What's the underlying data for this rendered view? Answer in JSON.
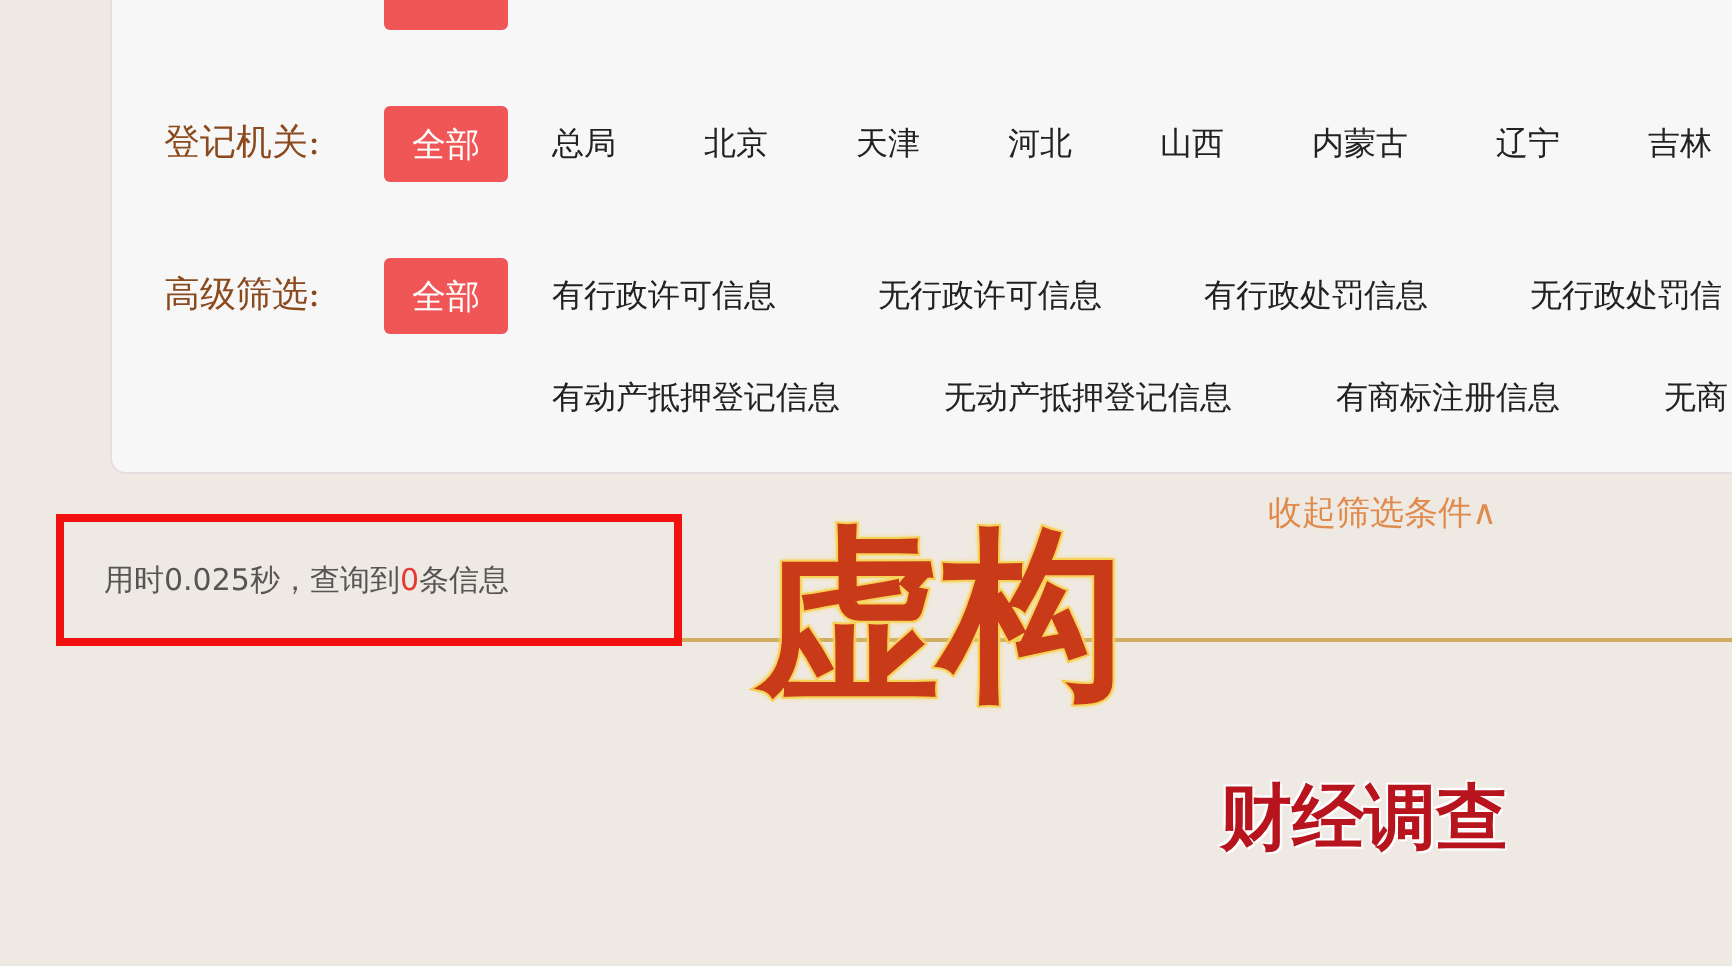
{
  "filters": [
    {
      "all_button": {
        "selected": true
      }
    },
    {
      "label": "登记机关:",
      "all_button": {
        "label": "全部",
        "selected": true
      },
      "lines": [
        [
          {
            "text": "总局",
            "selected": false
          },
          {
            "text": "北京",
            "selected": false
          },
          {
            "text": "天津",
            "selected": false
          },
          {
            "text": "河北",
            "selected": false
          },
          {
            "text": "山西",
            "selected": false
          },
          {
            "text": "内蒙古",
            "selected": false
          },
          {
            "text": "辽宁",
            "selected": false
          },
          {
            "text": "吉林",
            "selected": false
          }
        ]
      ]
    },
    {
      "label": "高级筛选:",
      "all_button": {
        "label": "全部",
        "selected": true
      },
      "lines": [
        [
          {
            "text": "有行政许可信息",
            "selected": false
          },
          {
            "text": "无行政许可信息",
            "selected": false
          },
          {
            "text": "有行政处罚信息",
            "selected": false
          },
          {
            "text": "无行政处罚信",
            "selected": false
          }
        ],
        [
          {
            "text": "有动产抵押登记信息",
            "selected": false
          },
          {
            "text": "无动产抵押登记信息",
            "selected": false
          },
          {
            "text": "有商标注册信息",
            "selected": false
          },
          {
            "text": "无商",
            "selected": false
          }
        ]
      ]
    }
  ],
  "collapse_link": "收起筛选条件∧",
  "result": {
    "prefix": "用时0.025秒，查询到",
    "count": "0",
    "suffix": "条信息",
    "highlighted": true
  },
  "caption_title": "虚构",
  "caption_tag": "财经调查"
}
